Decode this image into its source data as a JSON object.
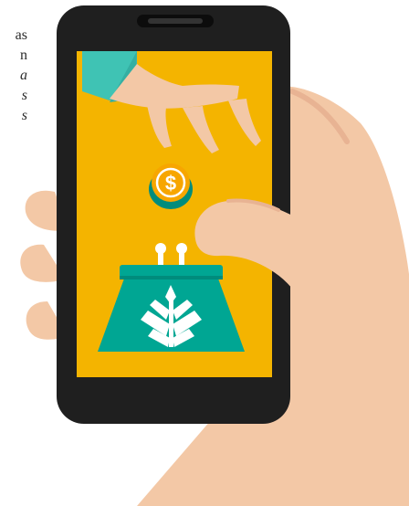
{
  "text_fragments": [
    {
      "text": "as",
      "italic": false
    },
    {
      "text": "n",
      "italic": false
    },
    {
      "text": "a",
      "italic": true
    },
    {
      "text": "s",
      "italic": true
    },
    {
      "text": "s",
      "italic": true
    }
  ],
  "coin": {
    "symbol": "$"
  },
  "icons": {
    "hand": "hand-holding-phone-icon",
    "phone": "smartphone-icon",
    "coin": "dollar-coin-icon",
    "purse": "coin-purse-icon",
    "logo": "wheat-spike-logo-icon"
  },
  "colors": {
    "screen": "#F4B400",
    "purse": "#00A693",
    "purse_dark": "#008C7C",
    "coin": "#F7A600",
    "coin_rim": "#00A693",
    "skin": "#F3C8A6",
    "skin_shadow": "#E8B393",
    "sleeve": "#3FC3B4",
    "phone_body": "#1f1f1f"
  }
}
